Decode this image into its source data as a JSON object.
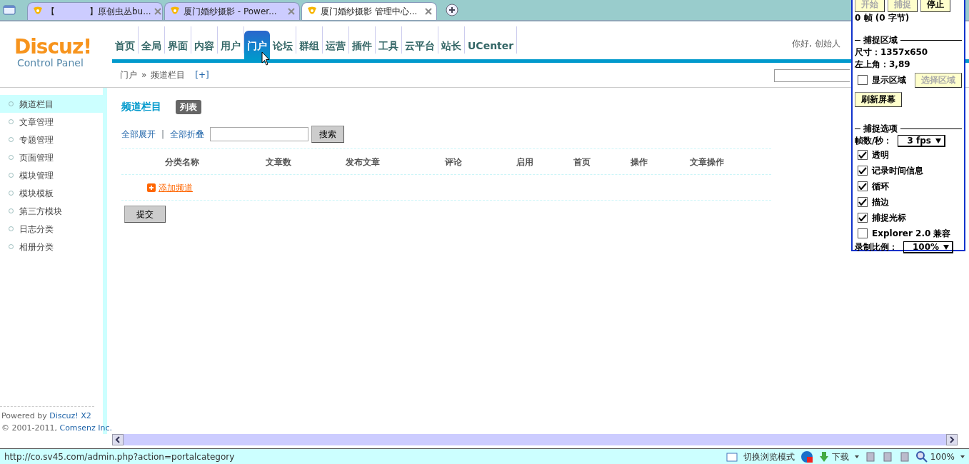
{
  "browser": {
    "tabs": [
      {
        "title": "【　　　　】原创虫丛bu...",
        "selected": false
      },
      {
        "title": "厦门婚纱摄影 - Power...",
        "selected": false
      },
      {
        "title": "厦门婚纱摄影 管理中心...",
        "selected": true
      }
    ],
    "status_url": "http://co.sv45.com/admin.php?action=portalcategory",
    "view_mode": "切换浏览模式",
    "download": "下载",
    "zoom": "100%"
  },
  "header": {
    "logo": "Discuz!",
    "logo_subtitle": "Control Panel",
    "nav": [
      {
        "label": "首页",
        "selected": false
      },
      {
        "label": "全局",
        "selected": false
      },
      {
        "label": "界面",
        "selected": false
      },
      {
        "label": "内容",
        "selected": false
      },
      {
        "label": "用户",
        "selected": false
      },
      {
        "label": "门户",
        "selected": true
      },
      {
        "label": "论坛",
        "selected": false
      },
      {
        "label": "群组",
        "selected": false
      },
      {
        "label": "运营",
        "selected": false
      },
      {
        "label": "插件",
        "selected": false
      },
      {
        "label": "工具",
        "selected": false
      },
      {
        "label": "云平台",
        "selected": false
      },
      {
        "label": "站长",
        "selected": false
      },
      {
        "label": "UCenter",
        "selected": false
      }
    ],
    "greeting": "你好, 创始人"
  },
  "breadcrumb": {
    "items": [
      "门户",
      "频道栏目"
    ],
    "separator": "»",
    "add": "[+]"
  },
  "sidebar": {
    "items": [
      {
        "label": "频道栏目",
        "selected": true
      },
      {
        "label": "文章管理",
        "selected": false
      },
      {
        "label": "专题管理",
        "selected": false
      },
      {
        "label": "页面管理",
        "selected": false
      },
      {
        "label": "模块管理",
        "selected": false
      },
      {
        "label": "模块模板",
        "selected": false
      },
      {
        "label": "第三方模块",
        "selected": false
      },
      {
        "label": "日志分类",
        "selected": false
      },
      {
        "label": "相册分类",
        "selected": false
      }
    ],
    "footer": [
      {
        "text": "Powered by ",
        "link": "Discuz! X2"
      },
      {
        "text": "© 2001-2011, ",
        "link": "Comsenz Inc."
      }
    ]
  },
  "content": {
    "title": "频道栏目",
    "badge": "列表",
    "links": [
      "全部展开",
      "全部折叠"
    ],
    "links_separator": "|",
    "search_button": "搜索",
    "columns": [
      "分类名称",
      "文章数",
      "发布文章",
      "评论",
      "启用",
      "首页",
      "操作",
      "文章操作"
    ],
    "add_link": "添加频道",
    "submit": "提交"
  },
  "capture_panel": {
    "buttons": [
      {
        "label": "开始",
        "disabled": true
      },
      {
        "label": "捕捉",
        "disabled": true
      },
      {
        "label": "停止",
        "disabled": false
      }
    ],
    "frames": "0 帧 (0 字节)",
    "area_title": "捕捉区域",
    "size": "尺寸：1357x650",
    "corner": "左上角：3,89",
    "show_area": {
      "label": "显示区域",
      "checked": false
    },
    "select_button": {
      "label": "选择区域",
      "disabled": true
    },
    "refresh": "刷新屏幕",
    "options_title": "捕捉选项",
    "fps_label": "帧数/秒：",
    "fps": "3 fps",
    "options": [
      {
        "label": "透明",
        "checked": true
      },
      {
        "label": "记录时间信息",
        "checked": true
      },
      {
        "label": "循环",
        "checked": true
      },
      {
        "label": "描边",
        "checked": true
      },
      {
        "label": "捕捉光标",
        "checked": true
      },
      {
        "label": "Explorer 2.0 兼容",
        "checked": false
      }
    ],
    "ratio_label": "录制比例：",
    "ratio": "100%"
  }
}
